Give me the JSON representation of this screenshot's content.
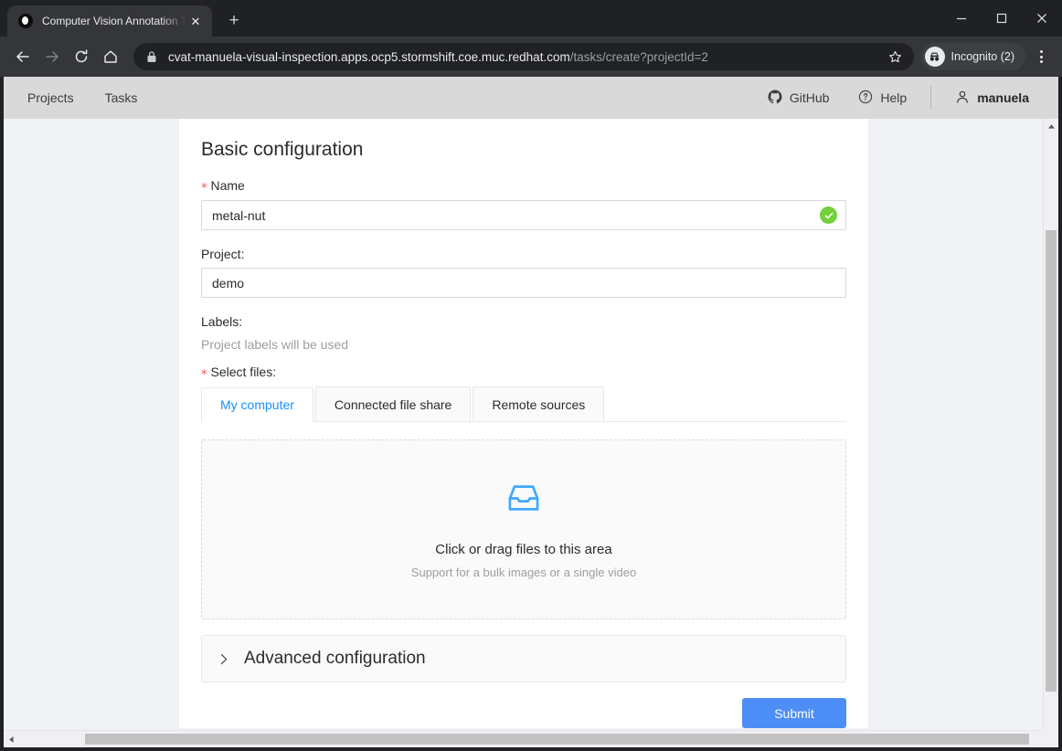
{
  "browser": {
    "tab": {
      "title": "Computer Vision Annotation T",
      "favicon_name": "cvat-favicon",
      "close_label": "✕"
    },
    "new_tab_label": "+",
    "window_controls": {
      "minimize": "—",
      "maximize": "□",
      "close": "✕"
    },
    "toolbar": {
      "back_label": "←",
      "forward_label": "→",
      "reload_label": "⟳",
      "home_label": "⌂",
      "url_host": "cvat-manuela-visual-inspection.apps.ocp5.stormshift.coe.muc.redhat.com",
      "url_path": "/tasks/create?projectId=2",
      "star_label": "☆",
      "profile_label": "Incognito (2)",
      "menu_label": "⋮"
    }
  },
  "app": {
    "nav": {
      "left_items": [
        {
          "label": "Projects"
        },
        {
          "label": "Tasks"
        }
      ],
      "github_label": "GitHub",
      "help_label": "Help",
      "username": "manuela"
    }
  },
  "main": {
    "card_title": "Basic configuration",
    "name_field": {
      "label": "Name",
      "required_marker": "*",
      "value": "metal-nut",
      "placeholder": "Name",
      "valid": true
    },
    "project_field": {
      "label": "Project:",
      "value": "demo",
      "placeholder": "Select project"
    },
    "labels_field": {
      "label": "Labels:",
      "hint": "Project labels will be used"
    },
    "select_files": {
      "label": "Select files:",
      "required_marker": "*",
      "tabs": [
        {
          "label": "My computer",
          "active": true
        },
        {
          "label": "Connected file share",
          "active": false
        },
        {
          "label": "Remote sources",
          "active": false
        }
      ],
      "dropzone": {
        "icon_name": "inbox-icon",
        "primary_text": "Click or drag files to this area",
        "secondary_text": "Support for a bulk images or a single video"
      }
    },
    "advanced": {
      "chevron": "›",
      "title": "Advanced configuration"
    },
    "submit_label": "Submit"
  },
  "colors": {
    "accent_blue": "#1890ff",
    "submit_blue": "#4c8ef5",
    "valid_green": "#73d13d",
    "required_red": "#ff4d4f",
    "page_bg": "#f0f2f5",
    "nav_bg": "#d9d9d9"
  }
}
